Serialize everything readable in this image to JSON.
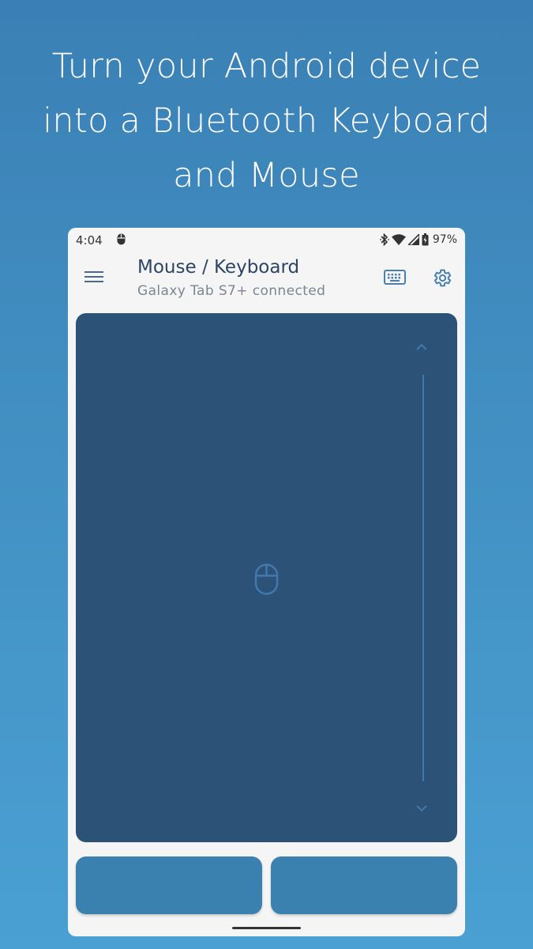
{
  "headline": {
    "line1": "Turn your Android device",
    "line2": "into a Bluetooth Keyboard",
    "line3": "and Mouse"
  },
  "status_bar": {
    "time": "4:04",
    "battery": "97%",
    "icons": [
      "mouse-icon",
      "bluetooth-icon",
      "wifi-icon",
      "signal-icon",
      "battery-icon"
    ]
  },
  "app_bar": {
    "title": "Mouse / Keyboard",
    "subtitle": "Galaxy Tab S7+ connected",
    "icons": [
      "menu-icon",
      "keyboard-icon",
      "settings-gear-icon"
    ]
  },
  "touchpad": {
    "icons": [
      "chevron-up-icon",
      "chevron-down-icon",
      "mouse-icon"
    ]
  },
  "colors": {
    "background_top": "#3a80b5",
    "background_bottom": "#4aa0d3",
    "phone_surface": "#f5f5f6",
    "touchpad": "#2c5277",
    "mouse_buttons": "#3b81b0",
    "title_text": "#2c4565",
    "accent_icon": "#4a7fb0"
  }
}
